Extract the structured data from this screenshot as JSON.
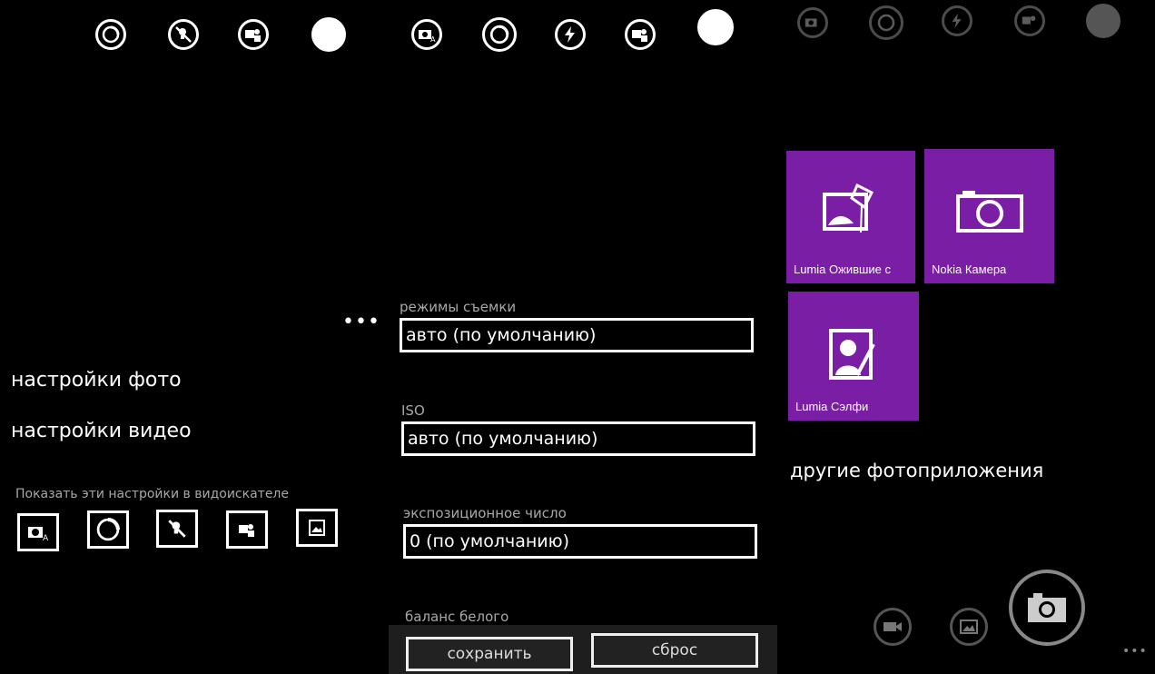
{
  "left_panel": {
    "menu_items": [
      "настройки фото",
      "настройки видео"
    ],
    "viewfinder_label": "Показать эти настройки в видоискателе",
    "more_dots": "•••"
  },
  "middle_panel": {
    "fields": [
      {
        "label": "режимы съемки",
        "value": "авто (по умолчанию)"
      },
      {
        "label": "ISO",
        "value": "авто (по умолчанию)"
      },
      {
        "label": "экспозиционное число",
        "value": "0 (по умолчанию)"
      }
    ],
    "white_balance_label": "баланс белого",
    "save_label": "сохранить",
    "reset_label": "сброс"
  },
  "right_panel": {
    "tiles": [
      {
        "name": "Lumia Ожившие с",
        "icon": "kite-photo-icon"
      },
      {
        "name": "Nokia Камера",
        "icon": "camera-icon"
      },
      {
        "name": "Lumia Сэлфи",
        "icon": "selfie-icon"
      }
    ],
    "other_apps_label": "другие фотоприложения",
    "more_dots": "•••"
  },
  "colors": {
    "tile": "#7a1ea5",
    "background": "#000000",
    "label_gray": "#a8a8a8"
  }
}
